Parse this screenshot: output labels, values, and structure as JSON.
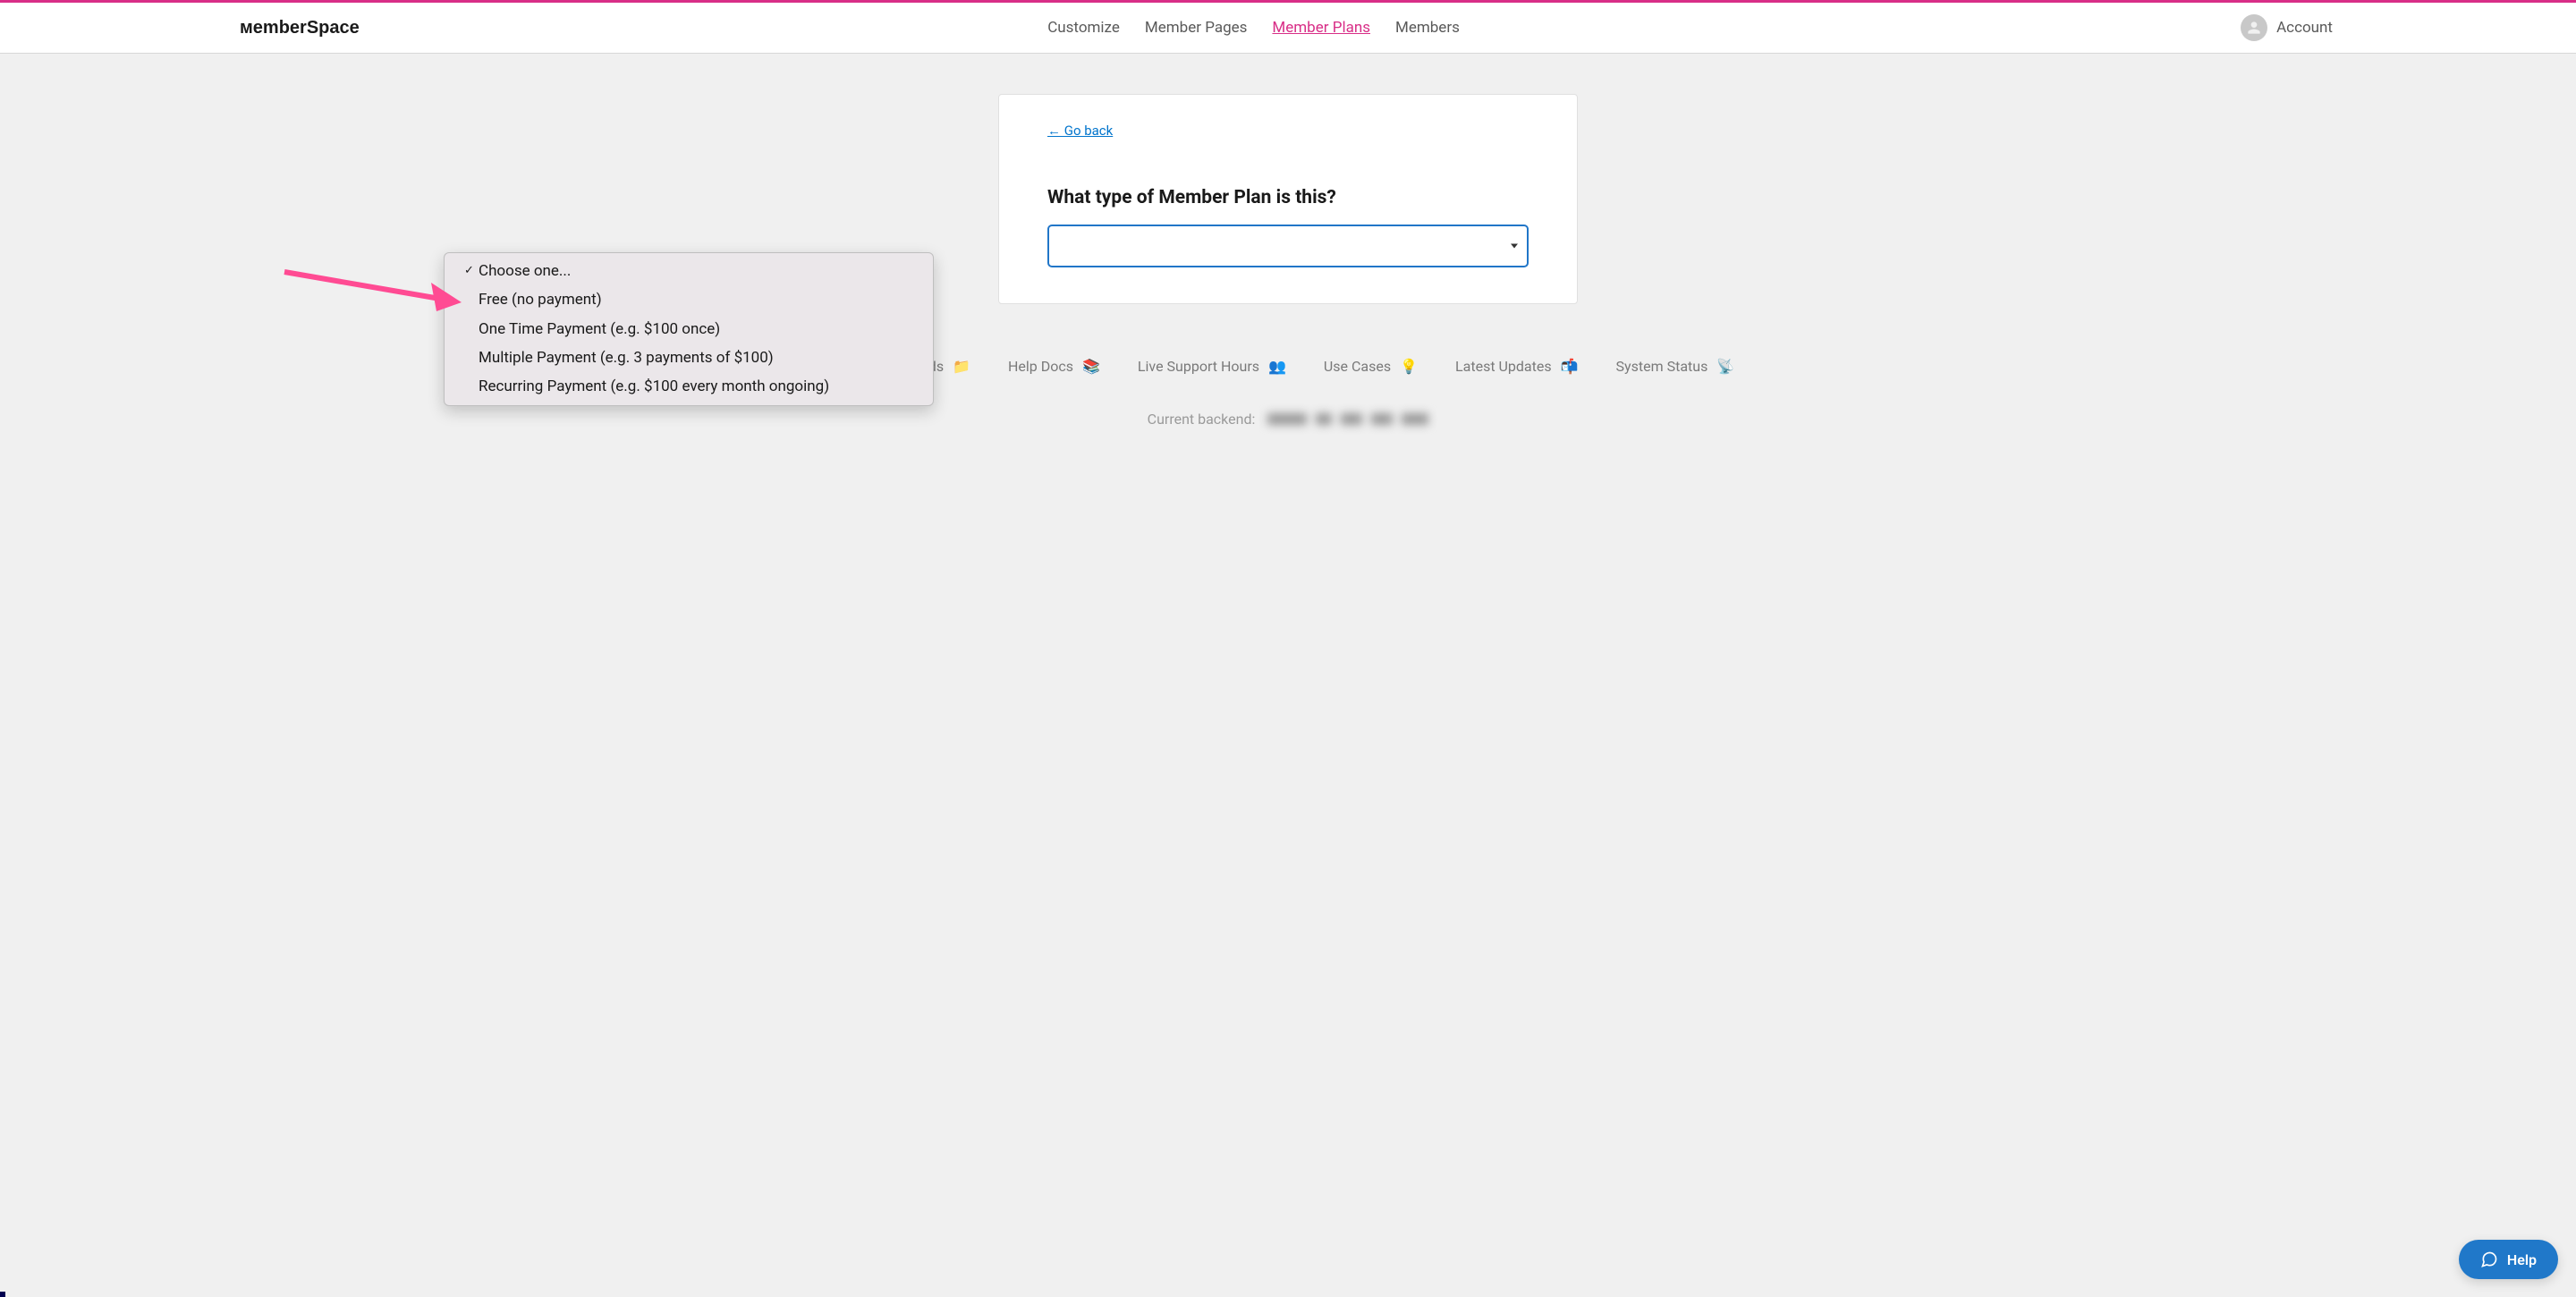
{
  "brand": "MemberSpace",
  "nav": {
    "customize": "Customize",
    "member_pages": "Member Pages",
    "member_plans": "Member Plans",
    "members": "Members"
  },
  "account_label": "Account",
  "card": {
    "go_back": "←  Go back",
    "question": "What type of Member Plan is this?"
  },
  "dropdown": {
    "options": [
      "Choose one...",
      "Free (no payment)",
      "One Time Payment (e.g. $100 once)",
      "Multiple Payment (e.g. 3 payments of $100)",
      "Recurring Payment (e.g. $100 every month ongoing)"
    ],
    "selected_index": 0
  },
  "footer": {
    "free_downloads": "Free Downloads",
    "help_docs": "Help Docs",
    "live_support": "Live Support Hours",
    "use_cases": "Use Cases",
    "latest_updates": "Latest Updates",
    "system_status": "System Status",
    "icons": {
      "free_downloads": "📁",
      "help_docs": "📚",
      "live_support": "👥",
      "use_cases": "💡",
      "latest_updates": "📬",
      "system_status": "📡"
    }
  },
  "backend_label": "Current backend:",
  "help_button": "Help"
}
